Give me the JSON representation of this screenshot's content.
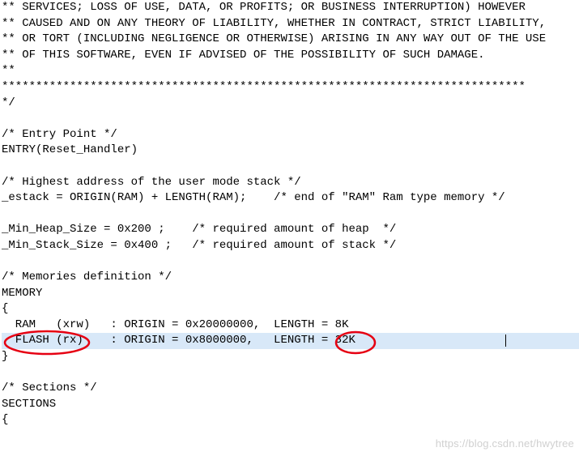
{
  "code": {
    "lines": [
      "** SERVICES; LOSS OF USE, DATA, OR PROFITS; OR BUSINESS INTERRUPTION) HOWEVER",
      "** CAUSED AND ON ANY THEORY OF LIABILITY, WHETHER IN CONTRACT, STRICT LIABILITY,",
      "** OR TORT (INCLUDING NEGLIGENCE OR OTHERWISE) ARISING IN ANY WAY OUT OF THE USE",
      "** OF THIS SOFTWARE, EVEN IF ADVISED OF THE POSSIBILITY OF SUCH DAMAGE.",
      "**",
      "*****************************************************************************",
      "*/",
      "",
      "/* Entry Point */",
      "ENTRY(Reset_Handler)",
      "",
      "/* Highest address of the user mode stack */",
      "_estack = ORIGIN(RAM) + LENGTH(RAM);    /* end of \"RAM\" Ram type memory */",
      "",
      "_Min_Heap_Size = 0x200 ;    /* required amount of heap  */",
      "_Min_Stack_Size = 0x400 ;   /* required amount of stack */",
      "",
      "/* Memories definition */",
      "MEMORY",
      "{",
      "  RAM   (xrw)   : ORIGIN = 0x20000000,  LENGTH = 8K",
      "  FLASH (rx)    : ORIGIN = 0x8000000,   LENGTH = 32K",
      "}",
      "",
      "/* Sections */",
      "SECTIONS",
      "{"
    ],
    "highlighted_line_index": 21
  },
  "annotations": {
    "circle1_label": "FLASH (rx)",
    "circle2_label": "32K"
  },
  "watermark": "https://blog.csdn.net/hwytree"
}
